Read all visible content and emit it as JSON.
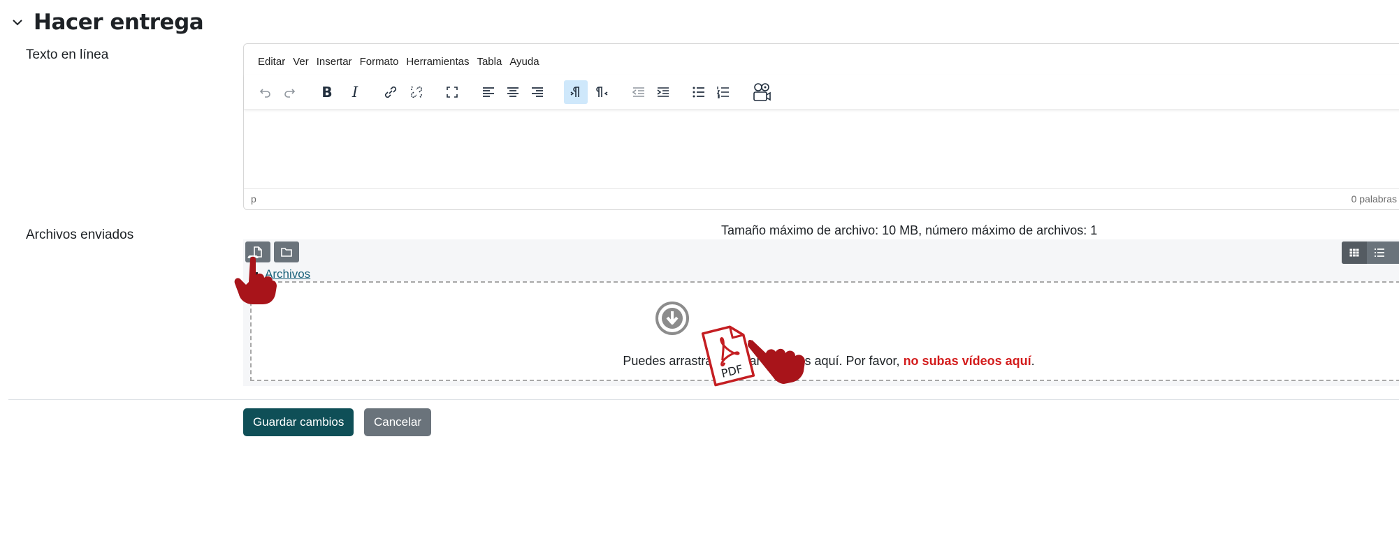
{
  "section": {
    "title": "Hacer entrega"
  },
  "online_text": {
    "label": "Texto en línea",
    "menu": [
      "Editar",
      "Ver",
      "Insertar",
      "Formato",
      "Herramientas",
      "Tabla",
      "Ayuda"
    ],
    "toolbar_icons": [
      "undo-icon",
      "redo-icon",
      "bold-icon",
      "italic-icon",
      "link-icon",
      "unlink-icon",
      "fullscreen-icon",
      "align-left-icon",
      "align-center-icon",
      "align-right-icon",
      "ltr-icon",
      "rtl-icon",
      "outdent-icon",
      "indent-icon",
      "bullet-list-icon",
      "numbered-list-icon",
      "media-recorder-icon"
    ],
    "toolbar_text": {
      "bold": "B",
      "italic": "I"
    },
    "status_path": "p",
    "word_count": "0 palabras"
  },
  "files": {
    "label": "Archivos enviados",
    "limits": "Tamaño máximo de archivo: 10 MB, número máximo de archivos: 1",
    "breadcrumb": "Archivos",
    "dropzone_text_prefix": "Puedes arrastrar y soltar archivos aquí. Por favor, ",
    "dropzone_text_warning": "no subas vídeos aquí",
    "dropzone_text_suffix": ".",
    "pdf_label": "PDF"
  },
  "actions": {
    "save_label": "Guardar cambios",
    "cancel_label": "Cancelar"
  },
  "colors": {
    "primary": "#0f4f57",
    "secondary": "#6a737b",
    "warning": "#d31c1c",
    "hand": "#a8141a"
  }
}
